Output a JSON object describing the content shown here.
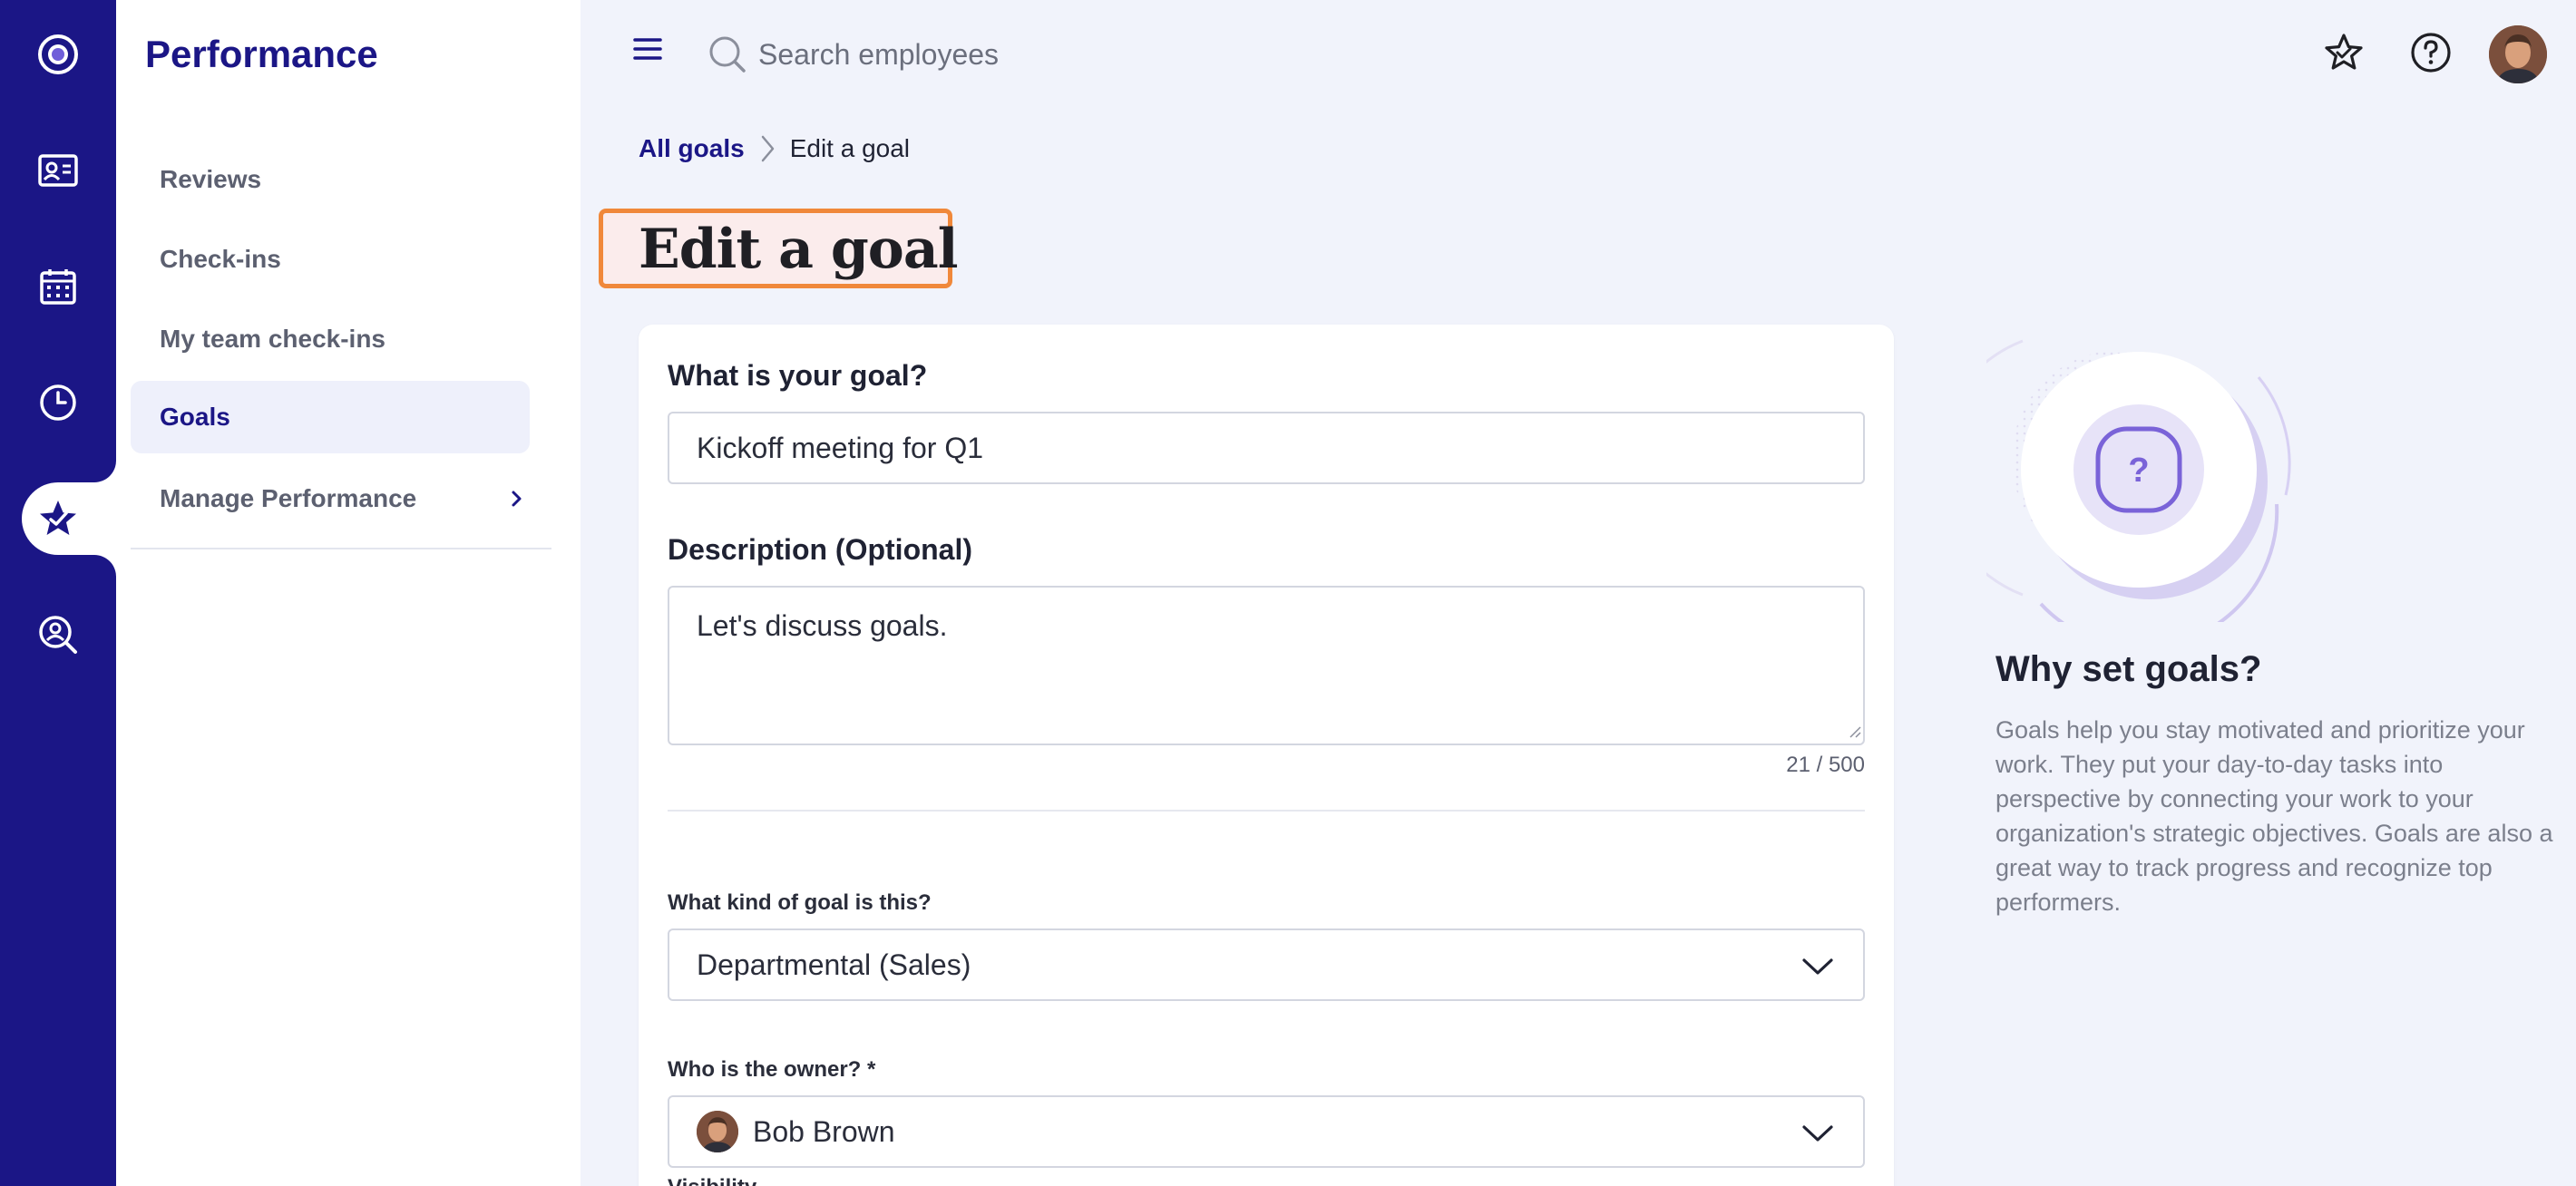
{
  "app": {
    "section_title": "Performance"
  },
  "rail": {
    "items": [
      {
        "icon": "logo-icon"
      },
      {
        "icon": "id-card-icon"
      },
      {
        "icon": "calendar-icon"
      },
      {
        "icon": "clock-icon"
      },
      {
        "icon": "star-badge-icon",
        "active": true
      },
      {
        "icon": "user-search-icon"
      }
    ]
  },
  "subnav": {
    "items": [
      {
        "label": "Reviews"
      },
      {
        "label": "Check-ins"
      },
      {
        "label": "My team check-ins"
      },
      {
        "label": "Goals",
        "active": true
      },
      {
        "label": "Manage Performance",
        "has_submenu": true
      }
    ]
  },
  "topbar": {
    "search_placeholder": "Search employees"
  },
  "breadcrumb": {
    "parent": "All goals",
    "current": "Edit a goal"
  },
  "page": {
    "title": "Edit a goal"
  },
  "form": {
    "goal_label": "What is your goal?",
    "goal_value": "Kickoff meeting for Q1",
    "description_label": "Description (Optional)",
    "description_value": "Let's discuss goals.",
    "description_counter": "21 / 500",
    "kind_label": "What kind of goal is this?",
    "kind_value": "Departmental (Sales)",
    "owner_label": "Who is the owner? *",
    "owner_value": "Bob Brown",
    "next_label_partial": "Visibility"
  },
  "info": {
    "title": "Why set goals?",
    "body": "Goals help you stay motivated and prioritize your work. They put your day-to-day tasks into perspective by connecting your work to your organization's strategic objectives. Goals are also a great way to track progress and recognize top performers."
  },
  "colors": {
    "brand": "#1b1686",
    "highlight_border": "#f0883a",
    "illustration": "#7a63d8"
  }
}
